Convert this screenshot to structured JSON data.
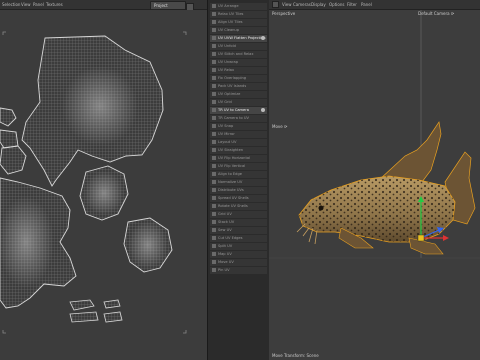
{
  "uv_editor": {
    "menu": [
      "Selection",
      "View",
      "Panel",
      "Textures"
    ],
    "projection_dropdown": "Project"
  },
  "command_menu": {
    "items": [
      {
        "label": "UV Arrange"
      },
      {
        "label": "Relax UV Tiles"
      },
      {
        "label": "Align UV Tiles"
      },
      {
        "label": "UV Cleanup"
      },
      {
        "label": "UV UVW Flatten Projection",
        "highlight": true,
        "has_dot": true
      },
      {
        "label": "UV Unfold"
      },
      {
        "label": "UV Stitch and Relax"
      },
      {
        "label": "UV Unwrap"
      },
      {
        "label": "UV Relax"
      },
      {
        "label": "Fix Overlapping"
      },
      {
        "label": "Pack UV Islands"
      },
      {
        "label": "UV Optimize"
      },
      {
        "label": "UV Grid"
      },
      {
        "label": "TR UV to Camera",
        "highlight": true,
        "has_dot": true
      },
      {
        "label": "TR Camera to UV"
      },
      {
        "label": "UV Snap"
      },
      {
        "label": "UV Mirror"
      },
      {
        "label": "Layout UV"
      },
      {
        "label": "UV Straighten"
      },
      {
        "label": "UV Flip Horizontal"
      },
      {
        "label": "UV Flip Vertical"
      },
      {
        "label": "Align to Edge"
      },
      {
        "label": "Normalize UV"
      },
      {
        "label": "Distribute UVs"
      },
      {
        "label": "Spread UV Shells"
      },
      {
        "label": "Rotate UV Shells"
      },
      {
        "label": "Grid UV"
      },
      {
        "label": "Stack UV"
      },
      {
        "label": "Sew UV"
      },
      {
        "label": "Cut UV Edges"
      },
      {
        "label": "Split UV"
      },
      {
        "label": "Map UV"
      },
      {
        "label": "Move UV"
      },
      {
        "label": "Pin UV"
      }
    ]
  },
  "viewport": {
    "menu": [
      "View",
      "Cameras",
      "Display",
      "Options",
      "Filter",
      "Panel"
    ],
    "camera_name": "Perspective",
    "camera_dropdown": "Default Camera ⟳",
    "tool_label": "Move ⟳",
    "status_text": "Move Transform: Scene"
  }
}
